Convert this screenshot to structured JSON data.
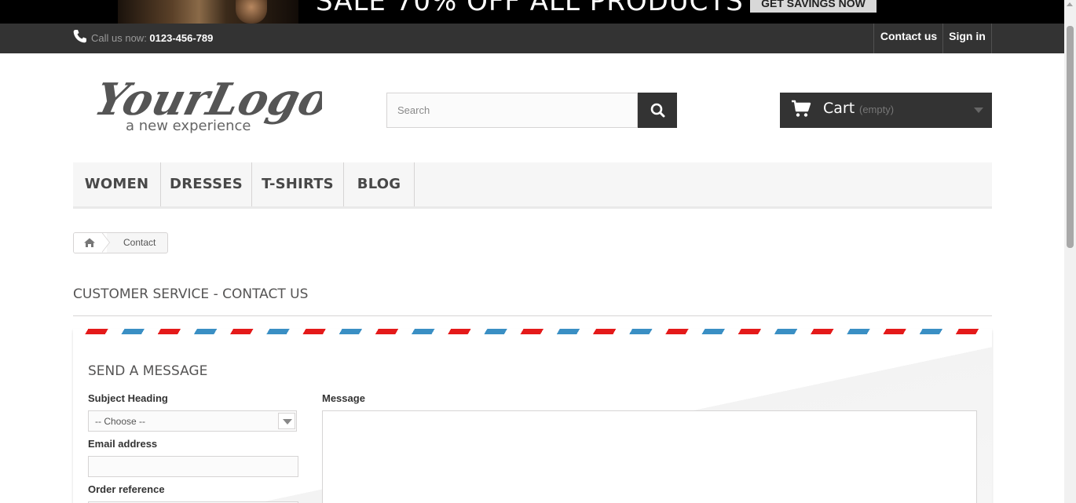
{
  "banner": {
    "text": "SALE 70% OFF ALL PRODUCTS",
    "button": "GET SAVINGS NOW"
  },
  "topbar": {
    "call_label": "Call us now: ",
    "phone": "0123-456-789",
    "contact_us": "Contact us",
    "sign_in": "Sign in"
  },
  "logo": {
    "main": "YourLogo",
    "tagline": "a new experience"
  },
  "search": {
    "placeholder": "Search"
  },
  "cart": {
    "label": "Cart",
    "status": "(empty)"
  },
  "nav": {
    "items": [
      "WOMEN",
      "DRESSES",
      "T-SHIRTS",
      "BLOG"
    ]
  },
  "breadcrumb": {
    "current": "Contact"
  },
  "page": {
    "heading": "CUSTOMER SERVICE - CONTACT US"
  },
  "form": {
    "title": "SEND A MESSAGE",
    "subject_label": "Subject Heading",
    "subject_value": "-- Choose --",
    "email_label": "Email address",
    "order_label": "Order reference",
    "message_label": "Message"
  },
  "colors": {
    "dark_bar": "#333333",
    "stripe_red": "#e41a1a",
    "stripe_blue": "#3a8fc4"
  }
}
